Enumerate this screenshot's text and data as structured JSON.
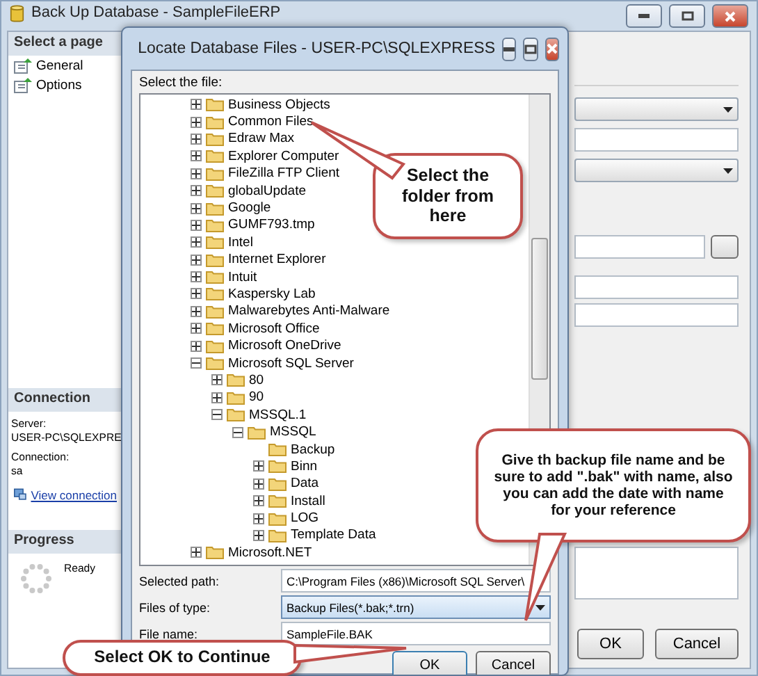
{
  "main_window": {
    "title": "Back Up Database - SampleFileERP",
    "sidebar_header": "Select a page",
    "pages": [
      "General",
      "Options"
    ],
    "connection": {
      "header": "Connection",
      "server_label": "Server:",
      "server": "USER-PC\\SQLEXPRE",
      "connection_label": "Connection:",
      "connection": "sa",
      "link": "View connection"
    },
    "progress": {
      "header": "Progress",
      "status": "Ready"
    },
    "buttons": [
      "OK",
      "Cancel"
    ]
  },
  "dialog": {
    "title": "Locate Database Files - USER-PC\\SQLEXPRESS",
    "tree_label": "Select the file:",
    "tree": [
      {
        "label": "Business Objects",
        "kind": "branch",
        "expanded": false
      },
      {
        "label": "Common Files",
        "kind": "branch",
        "expanded": false
      },
      {
        "label": "Edraw Max",
        "kind": "branch",
        "expanded": false
      },
      {
        "label": "Explorer Computer",
        "kind": "branch",
        "expanded": false
      },
      {
        "label": "FileZilla FTP Client",
        "kind": "branch",
        "expanded": false
      },
      {
        "label": "globalUpdate",
        "kind": "branch",
        "expanded": false
      },
      {
        "label": "Google",
        "kind": "branch",
        "expanded": false
      },
      {
        "label": "GUMF793.tmp",
        "kind": "branch",
        "expanded": false
      },
      {
        "label": "Intel",
        "kind": "branch",
        "expanded": false
      },
      {
        "label": "Internet Explorer",
        "kind": "branch",
        "expanded": false
      },
      {
        "label": "Intuit",
        "kind": "branch",
        "expanded": false
      },
      {
        "label": "Kaspersky Lab",
        "kind": "branch",
        "expanded": false
      },
      {
        "label": "Malwarebytes Anti-Malware",
        "kind": "branch",
        "expanded": false
      },
      {
        "label": "Microsoft Office",
        "kind": "branch",
        "expanded": false
      },
      {
        "label": "Microsoft OneDrive",
        "kind": "branch",
        "expanded": false
      },
      {
        "label": "Microsoft SQL Server",
        "kind": "branch",
        "expanded": true,
        "children": [
          {
            "label": "80",
            "kind": "branch",
            "expanded": false
          },
          {
            "label": "90",
            "kind": "branch",
            "expanded": false
          },
          {
            "label": "MSSQL.1",
            "kind": "branch",
            "expanded": true,
            "children": [
              {
                "label": "MSSQL",
                "kind": "branch",
                "expanded": true,
                "children": [
                  {
                    "label": "Backup",
                    "kind": "leaf"
                  },
                  {
                    "label": "Binn",
                    "kind": "branch",
                    "expanded": false
                  },
                  {
                    "label": "Data",
                    "kind": "branch",
                    "expanded": false
                  },
                  {
                    "label": "Install",
                    "kind": "branch",
                    "expanded": false
                  },
                  {
                    "label": "LOG",
                    "kind": "branch",
                    "expanded": false
                  },
                  {
                    "label": "Template Data",
                    "kind": "branch",
                    "expanded": false
                  }
                ]
              }
            ]
          }
        ]
      },
      {
        "label": "Microsoft.NET",
        "kind": "branch",
        "expanded": false
      }
    ],
    "selected_path_label": "Selected path:",
    "selected_path": "C:\\Program Files (x86)\\Microsoft SQL Server\\",
    "file_type_label": "Files of type:",
    "file_type": "Backup Files(*.bak;*.trn)",
    "file_name_label": "File name:",
    "file_name": "SampleFile.BAK",
    "buttons": [
      "OK",
      "Cancel"
    ]
  },
  "callouts": [
    {
      "text": "Select the folder from here"
    },
    {
      "text": "Give th backup file name and be sure to add \".bak\" with name, also you can add the date with name for your reference"
    },
    {
      "text": "Select OK to Continue"
    }
  ]
}
